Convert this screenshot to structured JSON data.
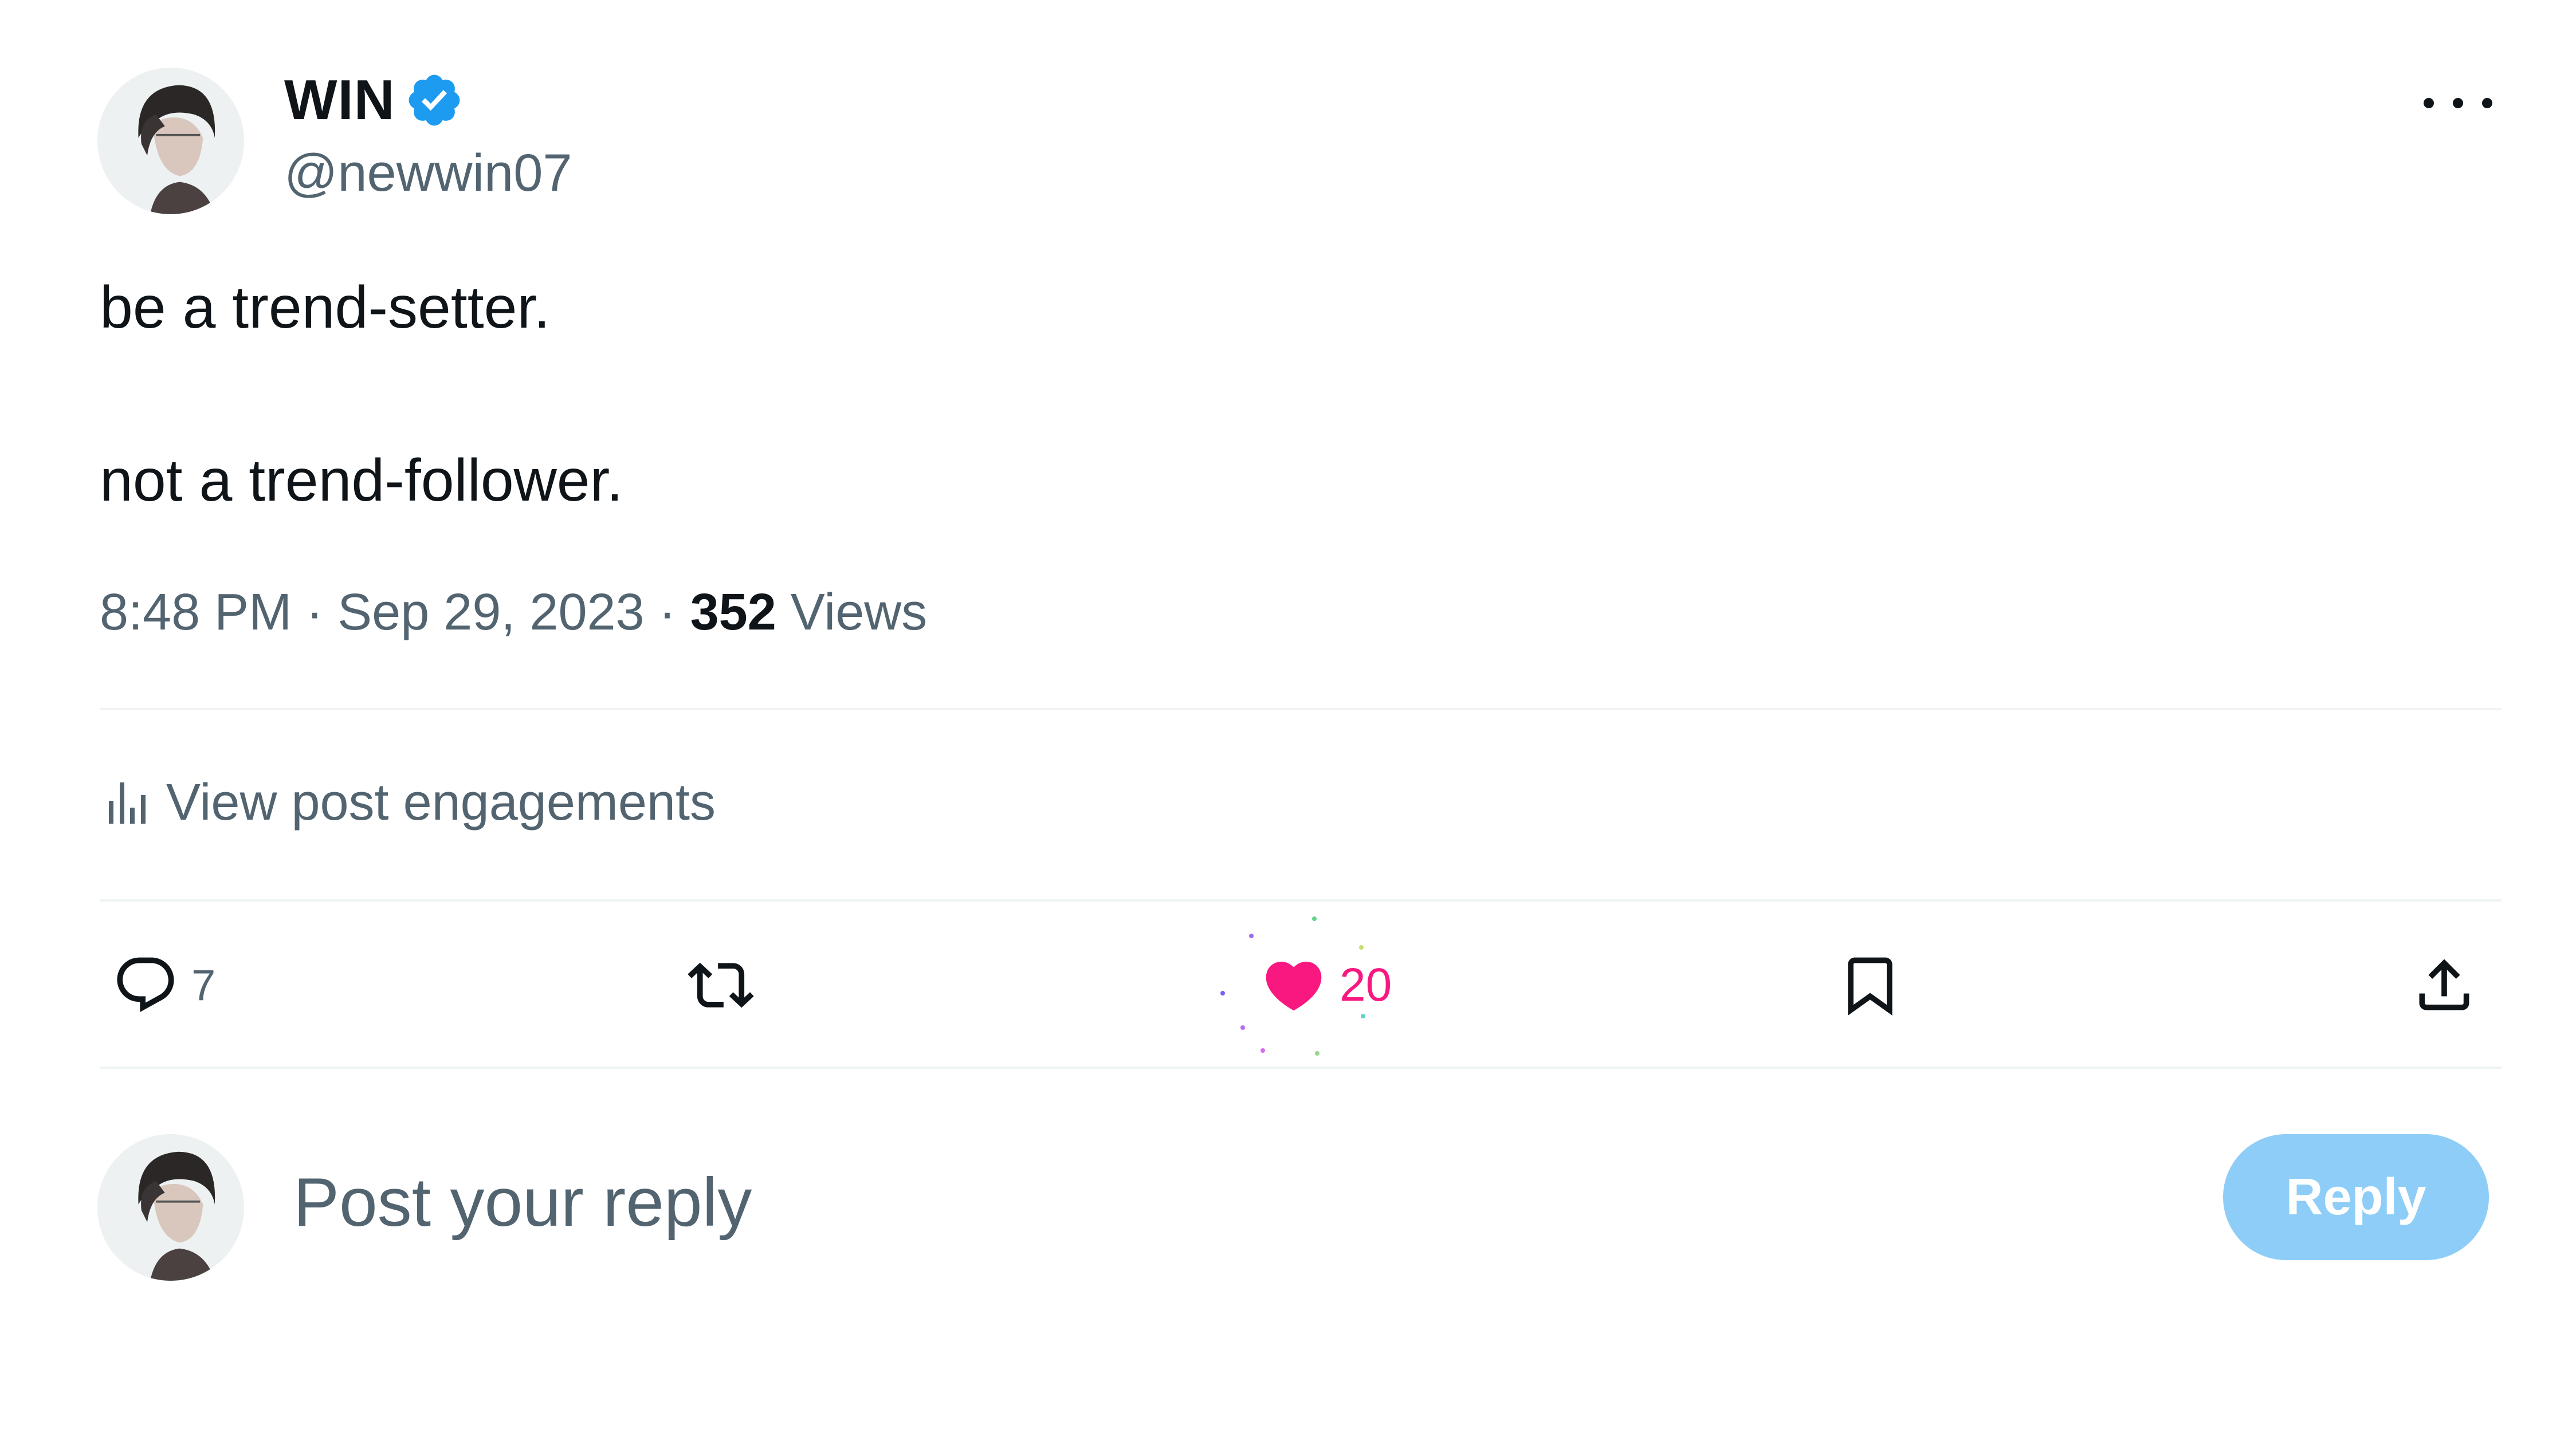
{
  "author": {
    "display_name": "WIN",
    "handle": "@newwin07"
  },
  "post": {
    "line1": "be a trend-setter.",
    "line2": "not a trend-follower."
  },
  "meta": {
    "time": "8:48 PM",
    "sep1": " · ",
    "date": "Sep 29, 2023",
    "sep2": " · ",
    "views_count": "352",
    "views_label": " Views"
  },
  "engagements": {
    "label": "View post engagements"
  },
  "actions": {
    "replies": "7",
    "likes": "20"
  },
  "composer": {
    "placeholder": "Post your reply",
    "button_label": "Reply"
  },
  "colors": {
    "like": "#f91880",
    "verified": "#1d9bf0",
    "reply_button": "#8ecdf7",
    "muted_text": "#536471"
  },
  "icons": [
    "verified-icon",
    "more-icon",
    "engagements-icon",
    "reply-icon",
    "repost-icon",
    "like-icon",
    "bookmark-icon",
    "share-icon"
  ]
}
